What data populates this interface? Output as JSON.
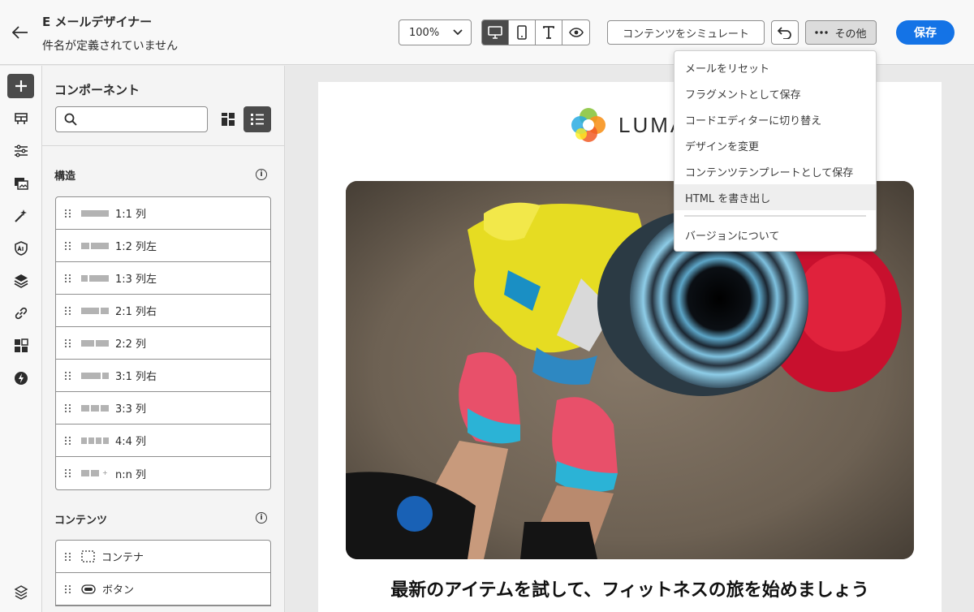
{
  "header": {
    "title": "E メールデザイナー",
    "subtitle": "件名が定義されていません",
    "zoom": "100%",
    "view_modes": [
      "desktop-icon",
      "mobile-icon",
      "text-icon",
      "preview-icon"
    ],
    "simulate_label": "コンテンツをシミュレート",
    "more_label": "その他",
    "save_label": "保存"
  },
  "rail": {
    "items": [
      "add-icon",
      "structure-icon",
      "settings-icon",
      "assets-icon",
      "ai-icon",
      "personalize-icon",
      "layers-icon",
      "link-icon",
      "fragments-icon",
      "lightning-icon",
      "layers-stack-icon"
    ]
  },
  "panel": {
    "title": "コンポーネント",
    "search_placeholder": "",
    "structure_title": "構造",
    "structure_items": [
      {
        "label": "1:1 列"
      },
      {
        "label": "1:2 列左"
      },
      {
        "label": "1:3 列左"
      },
      {
        "label": "2:1 列右"
      },
      {
        "label": "2:2 列"
      },
      {
        "label": "3:1 列右"
      },
      {
        "label": "3:3 列"
      },
      {
        "label": "4:4 列"
      },
      {
        "label": "n:n 列"
      }
    ],
    "content_title": "コンテンツ",
    "content_items": [
      {
        "label": "コンテナ"
      },
      {
        "label": "ボタン"
      }
    ]
  },
  "email": {
    "logo_text": "LUMA",
    "headline": "最新のアイテムを試して、フィットネスの旅を始めましょう"
  },
  "menu": {
    "items": [
      "メールをリセット",
      "フラグメントとして保存",
      "コードエディターに切り替え",
      "デザインを変更",
      "コンテンツテンプレートとして保存",
      "HTML を書き出し"
    ],
    "footer_item": "バージョンについて"
  },
  "colors": {
    "accent": "#1473e6",
    "selected": "#4b4b4b"
  }
}
